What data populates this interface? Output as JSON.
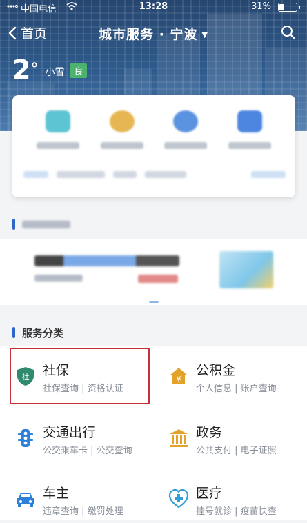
{
  "status": {
    "carrier": "中国电信",
    "time": "13:28",
    "battery": "31%",
    "battery_level": 0.31
  },
  "nav": {
    "back_label": "首页",
    "title": "城市服务 · 宁波",
    "caret": "▼"
  },
  "weather": {
    "temp": "2",
    "deg": "°",
    "condition": "小雪",
    "aqi": "良"
  },
  "sections": {
    "services_title": "服务分类"
  },
  "services": [
    {
      "name": "社保",
      "desc": "社保查询 | 资格认证",
      "icon": "social-security-shield-icon",
      "color": "#2f8a6e"
    },
    {
      "name": "公积金",
      "desc": "个人信息 | 账户查询",
      "icon": "housing-fund-house-icon",
      "color": "#e3a32a"
    },
    {
      "name": "交通出行",
      "desc": "公交乘车卡 | 公交查询",
      "icon": "traffic-light-icon",
      "color": "#2d7fd8"
    },
    {
      "name": "政务",
      "desc": "公共支付 | 电子证照",
      "icon": "government-building-icon",
      "color": "#e3a32a"
    },
    {
      "name": "车主",
      "desc": "违章查询 | 缴罚处理",
      "icon": "car-icon",
      "color": "#2d7fd8"
    },
    {
      "name": "医疗",
      "desc": "挂号就诊 | 疫苗快查",
      "icon": "medical-cross-icon",
      "color": "#2f9fd8"
    }
  ]
}
